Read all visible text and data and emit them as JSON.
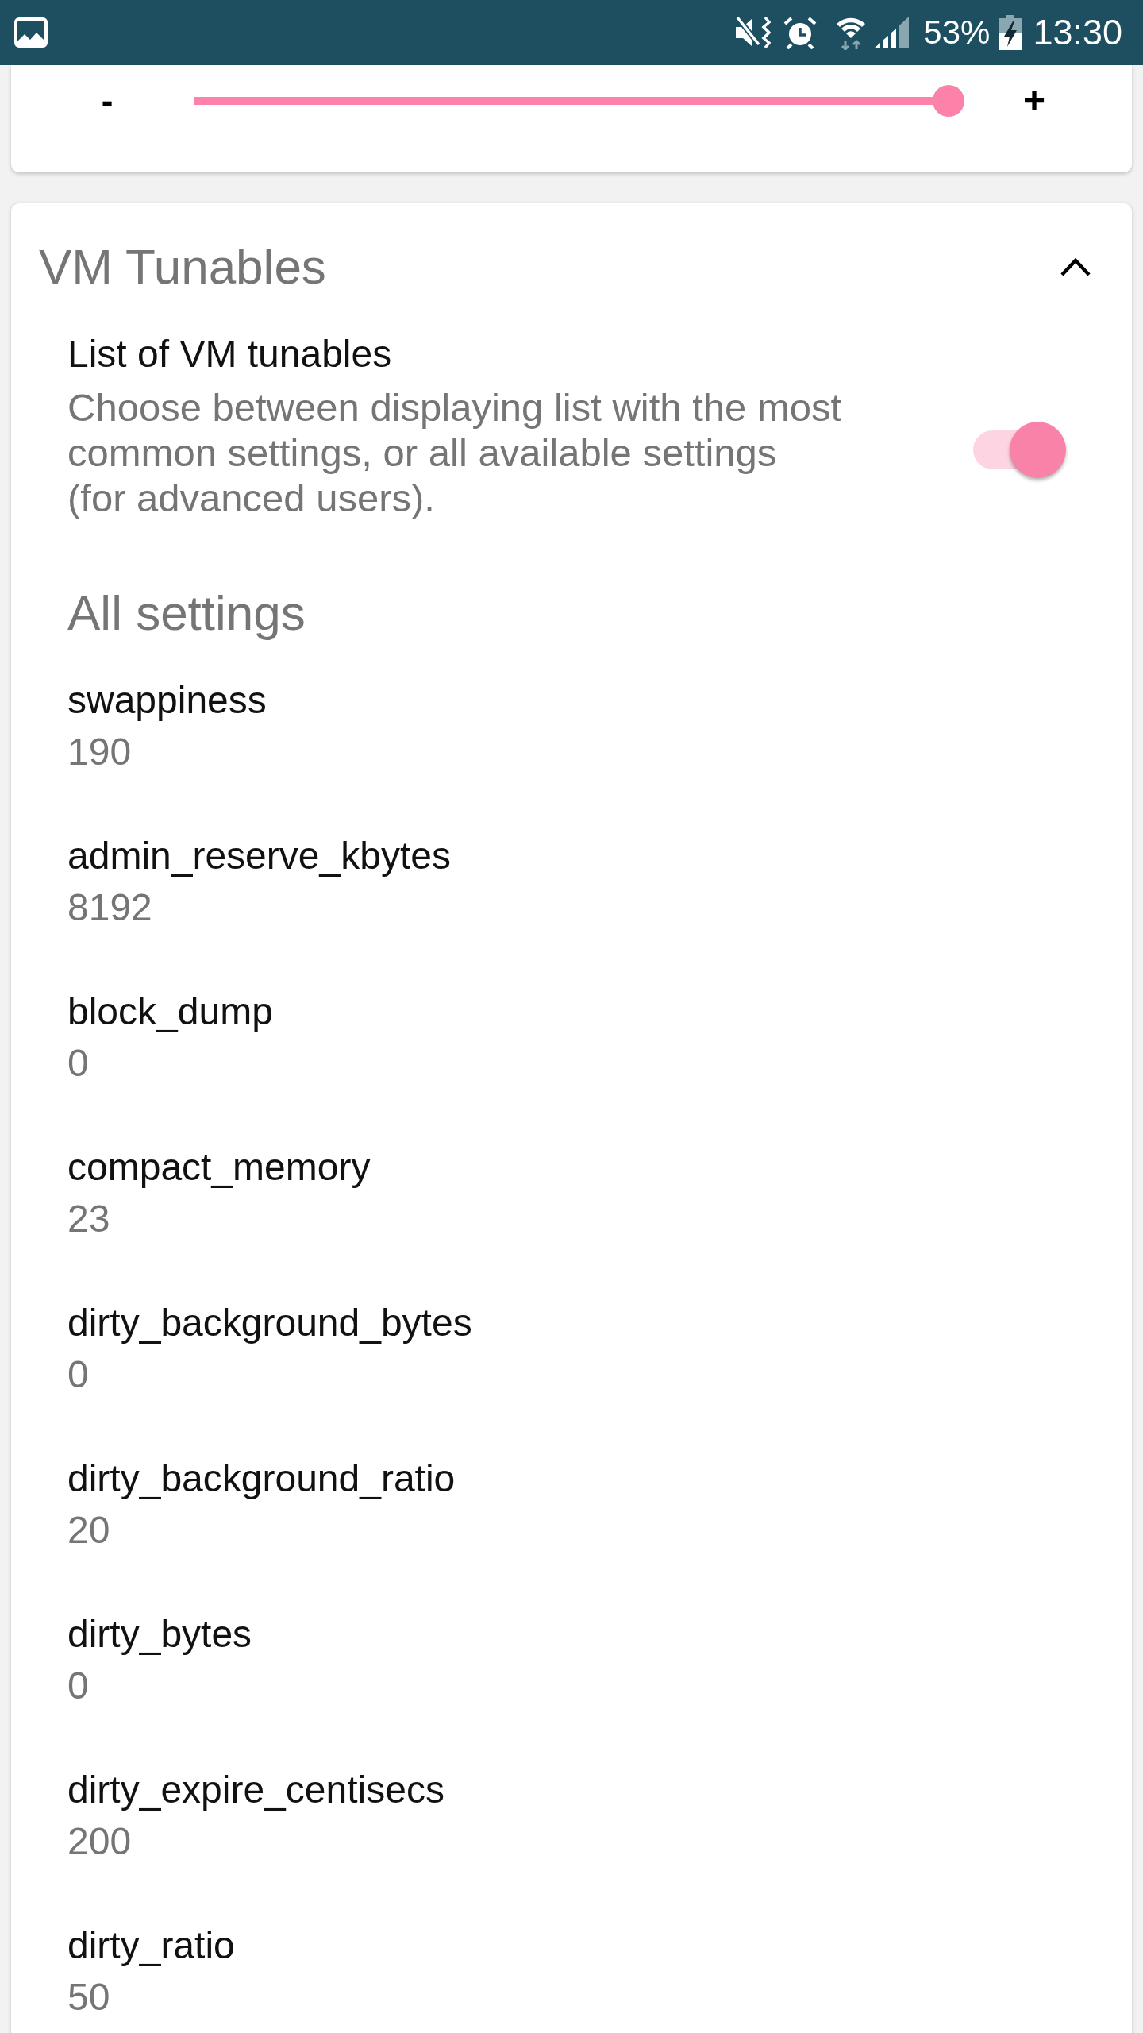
{
  "status_bar": {
    "battery": "53%",
    "time": "13:30"
  },
  "slider_card": {
    "decrease_label": "-",
    "increase_label": "+",
    "slider": {
      "level": 1
    }
  },
  "vm_tunables": {
    "title": "VM Tunables",
    "expanded": true,
    "list_toggle": {
      "title": "List of VM tunables",
      "description": "Choose between displaying list with the most common settings, or all available settings (for advanced users).",
      "on": true
    },
    "section_title": "All settings",
    "settings": [
      {
        "name": "swappiness",
        "value": "190"
      },
      {
        "name": "admin_reserve_kbytes",
        "value": "8192"
      },
      {
        "name": "block_dump",
        "value": "0"
      },
      {
        "name": "compact_memory",
        "value": "23"
      },
      {
        "name": "dirty_background_bytes",
        "value": "0"
      },
      {
        "name": "dirty_background_ratio",
        "value": "20"
      },
      {
        "name": "dirty_bytes",
        "value": "0"
      },
      {
        "name": "dirty_expire_centisecs",
        "value": "200"
      },
      {
        "name": "dirty_ratio",
        "value": "50"
      }
    ]
  }
}
